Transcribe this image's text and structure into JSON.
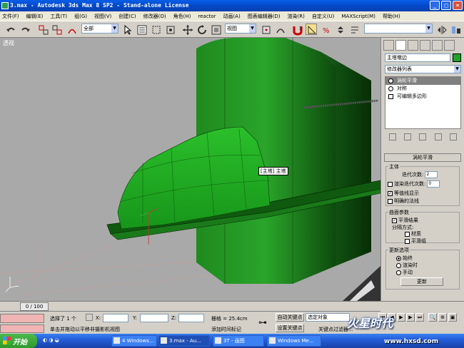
{
  "window": {
    "title": "3.max - Autodesk 3ds Max 8 SP2 - Stand-alone License"
  },
  "menu": [
    "文件(F)",
    "编辑(E)",
    "工具(T)",
    "组(G)",
    "视图(V)",
    "创建(C)",
    "修改器(O)",
    "角色(H)",
    "reactor",
    "动画(A)",
    "图表编辑器(D)",
    "渲染(R)",
    "自定义(U)",
    "MAXScript(M)",
    "帮助(H)"
  ],
  "toolbar": {
    "selection_filter": "全部",
    "ref_coord": "视图"
  },
  "viewport": {
    "label": "透视",
    "object_tag": "[主塔] 主塔"
  },
  "command_panel": {
    "object_name": "主塔墩边",
    "object_color": "#1fa32b",
    "modifier_list": "修改器列表",
    "stack": [
      "涡轮平滑",
      "对称",
      "可编辑多边形"
    ],
    "rollout_title": "涡轮平滑",
    "main_group": {
      "title": "主体",
      "iterations_label": "迭代次数:",
      "iterations_value": "2",
      "render_iters_label": "渲染迭代次数:",
      "render_iters_value": "0",
      "isoline_label": "等值线显示",
      "explicit_normals_label": "明确的法线"
    },
    "surface_group": {
      "title": "曲面参数",
      "smooth_result_label": "平滑结果",
      "separate_label": "分隔方式:",
      "material_label": "材质",
      "smoothing_groups_label": "平滑组"
    },
    "update_group": {
      "title": "更新选项",
      "always_label": "始终",
      "when_rendering_label": "渲染时",
      "manual_label": "手动",
      "update_button": "更新"
    }
  },
  "timeline": {
    "position": "0 / 100"
  },
  "statusbar": {
    "selected": "选择了 1 个",
    "x_label": "X:",
    "y_label": "Y:",
    "z_label": "Z:",
    "grid": "栅格 = 25.4cm",
    "prompt": "单击并拖动以平移非摄影机视图",
    "add_time_tag": "添加时间标记",
    "auto_key": "自动关键点",
    "set_key": "设置关键点",
    "selected_object": "选定对象",
    "key_filters": "关键点过滤器..."
  },
  "taskbar": {
    "start": "开始",
    "tasks": [
      "4 Windows...",
      "3.max - Au...",
      "3T - 画图",
      "Windows Me..."
    ],
    "active_task_index": 1
  },
  "watermark": {
    "brand": "火星时代",
    "url": "www.hxsd.com"
  }
}
